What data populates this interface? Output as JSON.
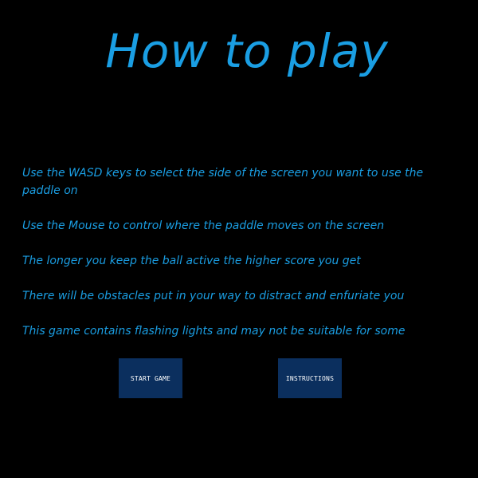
{
  "title": "How to play",
  "instructions": [
    "Use the WASD keys to select the side of the screen you want to use the paddle on",
    "Use the Mouse to control where the paddle moves on the screen",
    "The longer you keep the ball active the higher score you get",
    "There will be obstacles put in your way to distract and enfuriate you",
    "This game contains flashing lights and may not be suitable for some"
  ],
  "buttons": {
    "start_game": "START GAME",
    "instructions": "INSTRUCTIONS"
  },
  "colors": {
    "background": "#000000",
    "text": "#1a9ee3",
    "button_bg": "#0b2f5e",
    "button_text": "#ffffff"
  }
}
